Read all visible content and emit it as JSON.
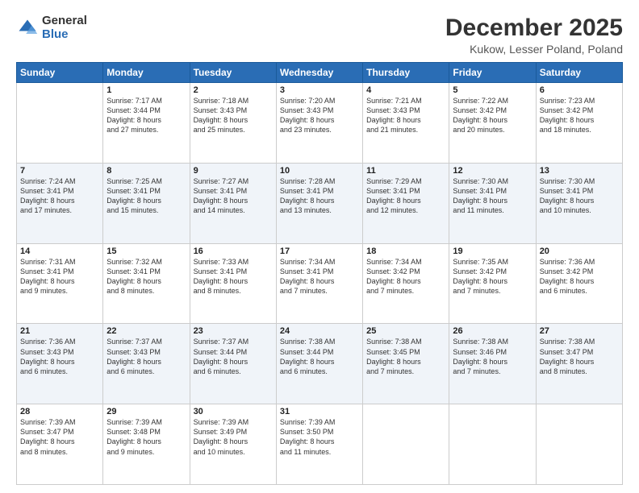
{
  "logo": {
    "general": "General",
    "blue": "Blue"
  },
  "header": {
    "title": "December 2025",
    "subtitle": "Kukow, Lesser Poland, Poland"
  },
  "days_header": [
    "Sunday",
    "Monday",
    "Tuesday",
    "Wednesday",
    "Thursday",
    "Friday",
    "Saturday"
  ],
  "weeks": [
    [
      {
        "day": "",
        "text": ""
      },
      {
        "day": "1",
        "text": "Sunrise: 7:17 AM\nSunset: 3:44 PM\nDaylight: 8 hours\nand 27 minutes."
      },
      {
        "day": "2",
        "text": "Sunrise: 7:18 AM\nSunset: 3:43 PM\nDaylight: 8 hours\nand 25 minutes."
      },
      {
        "day": "3",
        "text": "Sunrise: 7:20 AM\nSunset: 3:43 PM\nDaylight: 8 hours\nand 23 minutes."
      },
      {
        "day": "4",
        "text": "Sunrise: 7:21 AM\nSunset: 3:43 PM\nDaylight: 8 hours\nand 21 minutes."
      },
      {
        "day": "5",
        "text": "Sunrise: 7:22 AM\nSunset: 3:42 PM\nDaylight: 8 hours\nand 20 minutes."
      },
      {
        "day": "6",
        "text": "Sunrise: 7:23 AM\nSunset: 3:42 PM\nDaylight: 8 hours\nand 18 minutes."
      }
    ],
    [
      {
        "day": "7",
        "text": "Sunrise: 7:24 AM\nSunset: 3:41 PM\nDaylight: 8 hours\nand 17 minutes."
      },
      {
        "day": "8",
        "text": "Sunrise: 7:25 AM\nSunset: 3:41 PM\nDaylight: 8 hours\nand 15 minutes."
      },
      {
        "day": "9",
        "text": "Sunrise: 7:27 AM\nSunset: 3:41 PM\nDaylight: 8 hours\nand 14 minutes."
      },
      {
        "day": "10",
        "text": "Sunrise: 7:28 AM\nSunset: 3:41 PM\nDaylight: 8 hours\nand 13 minutes."
      },
      {
        "day": "11",
        "text": "Sunrise: 7:29 AM\nSunset: 3:41 PM\nDaylight: 8 hours\nand 12 minutes."
      },
      {
        "day": "12",
        "text": "Sunrise: 7:30 AM\nSunset: 3:41 PM\nDaylight: 8 hours\nand 11 minutes."
      },
      {
        "day": "13",
        "text": "Sunrise: 7:30 AM\nSunset: 3:41 PM\nDaylight: 8 hours\nand 10 minutes."
      }
    ],
    [
      {
        "day": "14",
        "text": "Sunrise: 7:31 AM\nSunset: 3:41 PM\nDaylight: 8 hours\nand 9 minutes."
      },
      {
        "day": "15",
        "text": "Sunrise: 7:32 AM\nSunset: 3:41 PM\nDaylight: 8 hours\nand 8 minutes."
      },
      {
        "day": "16",
        "text": "Sunrise: 7:33 AM\nSunset: 3:41 PM\nDaylight: 8 hours\nand 8 minutes."
      },
      {
        "day": "17",
        "text": "Sunrise: 7:34 AM\nSunset: 3:41 PM\nDaylight: 8 hours\nand 7 minutes."
      },
      {
        "day": "18",
        "text": "Sunrise: 7:34 AM\nSunset: 3:42 PM\nDaylight: 8 hours\nand 7 minutes."
      },
      {
        "day": "19",
        "text": "Sunrise: 7:35 AM\nSunset: 3:42 PM\nDaylight: 8 hours\nand 7 minutes."
      },
      {
        "day": "20",
        "text": "Sunrise: 7:36 AM\nSunset: 3:42 PM\nDaylight: 8 hours\nand 6 minutes."
      }
    ],
    [
      {
        "day": "21",
        "text": "Sunrise: 7:36 AM\nSunset: 3:43 PM\nDaylight: 8 hours\nand 6 minutes."
      },
      {
        "day": "22",
        "text": "Sunrise: 7:37 AM\nSunset: 3:43 PM\nDaylight: 8 hours\nand 6 minutes."
      },
      {
        "day": "23",
        "text": "Sunrise: 7:37 AM\nSunset: 3:44 PM\nDaylight: 8 hours\nand 6 minutes."
      },
      {
        "day": "24",
        "text": "Sunrise: 7:38 AM\nSunset: 3:44 PM\nDaylight: 8 hours\nand 6 minutes."
      },
      {
        "day": "25",
        "text": "Sunrise: 7:38 AM\nSunset: 3:45 PM\nDaylight: 8 hours\nand 7 minutes."
      },
      {
        "day": "26",
        "text": "Sunrise: 7:38 AM\nSunset: 3:46 PM\nDaylight: 8 hours\nand 7 minutes."
      },
      {
        "day": "27",
        "text": "Sunrise: 7:38 AM\nSunset: 3:47 PM\nDaylight: 8 hours\nand 8 minutes."
      }
    ],
    [
      {
        "day": "28",
        "text": "Sunrise: 7:39 AM\nSunset: 3:47 PM\nDaylight: 8 hours\nand 8 minutes."
      },
      {
        "day": "29",
        "text": "Sunrise: 7:39 AM\nSunset: 3:48 PM\nDaylight: 8 hours\nand 9 minutes."
      },
      {
        "day": "30",
        "text": "Sunrise: 7:39 AM\nSunset: 3:49 PM\nDaylight: 8 hours\nand 10 minutes."
      },
      {
        "day": "31",
        "text": "Sunrise: 7:39 AM\nSunset: 3:50 PM\nDaylight: 8 hours\nand 11 minutes."
      },
      {
        "day": "",
        "text": ""
      },
      {
        "day": "",
        "text": ""
      },
      {
        "day": "",
        "text": ""
      }
    ]
  ]
}
